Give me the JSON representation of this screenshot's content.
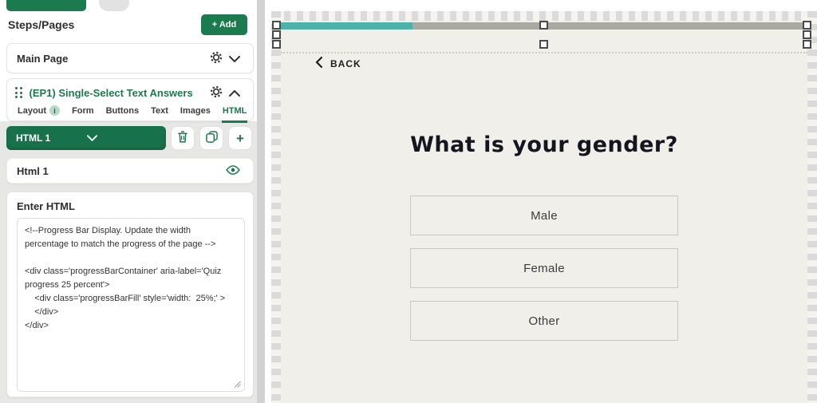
{
  "sidebar": {
    "title": "Steps/Pages",
    "add_button": "+ Add",
    "main_page_label": "Main Page",
    "element_title": "(EP1) Single-Select Text Answers",
    "tabs": {
      "layout": "Layout",
      "layout_info": "i",
      "form": "Form",
      "buttons": "Buttons",
      "text": "Text",
      "images": "Images",
      "html": "HTML"
    },
    "html_selector": "HTML 1",
    "html_name": "Html 1",
    "editor_label": "Enter HTML",
    "code": "<!--Progress Bar Display. Update the width percentage to match the progress of the page -->\n\n<div class='progressBarContainer' aria-label='Quiz progress 25 percent'>\n    <div class='progressBarFill' style='width:  25%;' >\n    </div>\n</div>"
  },
  "preview": {
    "back": "BACK",
    "question": "What is your gender?",
    "answers": [
      "Male",
      "Female",
      "Other"
    ],
    "progress_percent": 25
  },
  "colors": {
    "brand_green": "#1b7a4e",
    "progress_fill": "#4db3aa",
    "progress_track": "#a9a9a2",
    "canvas_bg": "#f0efe9"
  }
}
